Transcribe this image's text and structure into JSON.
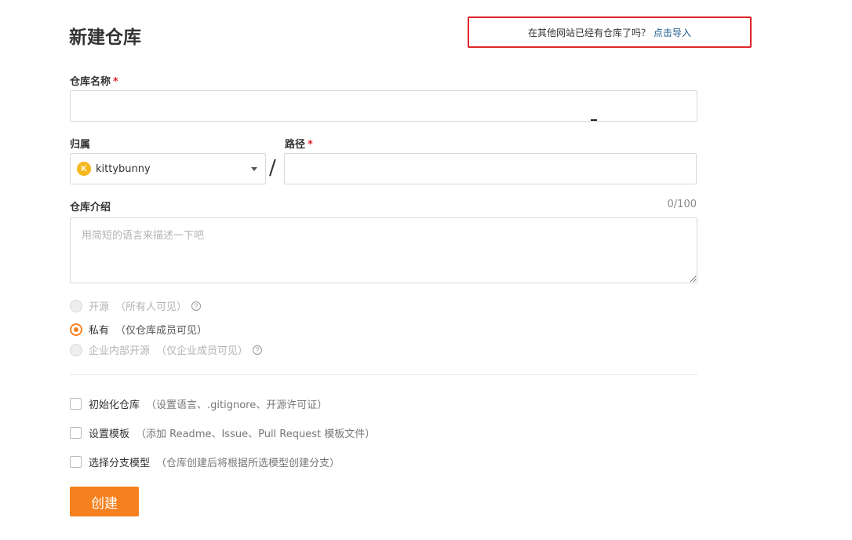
{
  "page": {
    "title": "新建仓库",
    "import_prompt": "在其他网站已经有仓库了吗？",
    "import_link": "点击导入"
  },
  "form": {
    "repo_name": {
      "label": "仓库名称",
      "required_mark": "*",
      "value": ""
    },
    "owner": {
      "label": "归属",
      "avatar_letter": "K",
      "value": "kittybunny",
      "separator": "/"
    },
    "path": {
      "label": "路径",
      "required_mark": "*",
      "value": ""
    },
    "description": {
      "label": "仓库介绍",
      "counter": "0/100",
      "placeholder": "用简短的语言来描述一下吧",
      "value": ""
    },
    "visibility": [
      {
        "label": "开源",
        "hint": "（所有人可见）",
        "checked": false,
        "disabled": true,
        "has_help": true
      },
      {
        "label": "私有",
        "hint": "（仅仓库成员可见）",
        "checked": true,
        "disabled": false,
        "has_help": false
      },
      {
        "label": "企业内部开源",
        "hint": "（仅企业成员可见）",
        "checked": false,
        "disabled": true,
        "has_help": true
      }
    ],
    "help_glyph": "?",
    "options": [
      {
        "label": "初始化仓库",
        "hint": "（设置语言、.gitignore、开源许可证）",
        "checked": false
      },
      {
        "label": "设置模板",
        "hint": "（添加 Readme、Issue、Pull Request 模板文件）",
        "checked": false
      },
      {
        "label": "选择分支模型",
        "hint": "（仓库创建后将根据所选模型创建分支）",
        "checked": false
      }
    ],
    "submit_label": "创建"
  },
  "colors": {
    "accent": "#f5801e",
    "required": "#e0262a",
    "highlight_border": "#e0262a",
    "link": "#1f5a8a"
  }
}
